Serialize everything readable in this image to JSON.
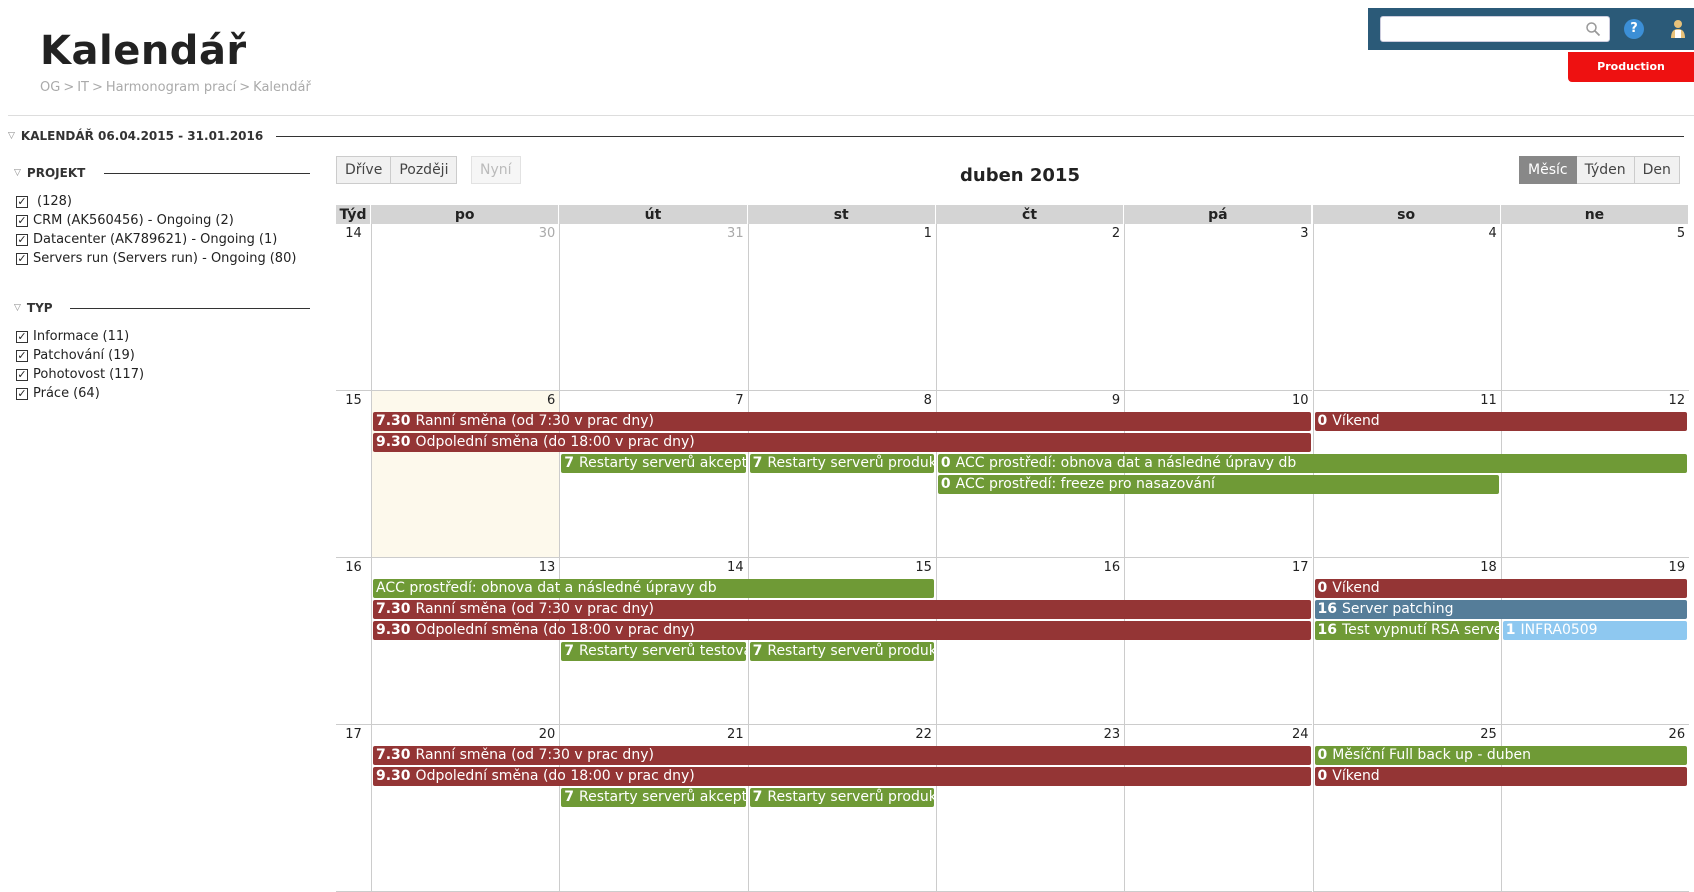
{
  "header": {
    "title": "Kalendář",
    "breadcrumb": [
      "OG",
      "IT",
      "Harmonogram prací",
      "Kalendář"
    ],
    "breadcrumb_sep": ">",
    "search_placeholder": "",
    "help_label": "?",
    "environment": "Production"
  },
  "calendar_section": {
    "title": "KALENDÁŘ 06.04.2015 - 31.01.2016"
  },
  "filters": {
    "project": {
      "title": "PROJEKT",
      "items": [
        {
          "label": "",
          "count": "(128)",
          "checked": true
        },
        {
          "label": "CRM (AK560456) - Ongoing",
          "count": "(2)",
          "checked": true
        },
        {
          "label": "Datacenter (AK789621) - Ongoing",
          "count": "(1)",
          "checked": true
        },
        {
          "label": "Servers run (Servers run) - Ongoing",
          "count": "(80)",
          "checked": true
        }
      ]
    },
    "type": {
      "title": "TYP",
      "items": [
        {
          "label": "Informace",
          "count": "(11)",
          "checked": true
        },
        {
          "label": "Patchování",
          "count": "(19)",
          "checked": true
        },
        {
          "label": "Pohotovost",
          "count": "(117)",
          "checked": true
        },
        {
          "label": "Práce",
          "count": "(64)",
          "checked": true
        }
      ]
    }
  },
  "toolbar": {
    "earlier": "Dříve",
    "later": "Později",
    "now": "Nyní",
    "month_title": "duben 2015",
    "views": [
      "Měsíc",
      "Týden",
      "Den"
    ],
    "active_view": "Měsíc"
  },
  "calendar": {
    "week_header": "Týd",
    "day_headers": [
      "po",
      "út",
      "st",
      "čt",
      "pá",
      "so",
      "ne"
    ],
    "weeks": [
      {
        "week": "14",
        "days": [
          {
            "num": "30",
            "other": true
          },
          {
            "num": "31",
            "other": true
          },
          {
            "num": "1"
          },
          {
            "num": "2"
          },
          {
            "num": "3"
          },
          {
            "num": "4"
          },
          {
            "num": "5"
          }
        ],
        "events": []
      },
      {
        "week": "15",
        "days": [
          {
            "num": "6",
            "today": true
          },
          {
            "num": "7"
          },
          {
            "num": "8"
          },
          {
            "num": "9"
          },
          {
            "num": "10"
          },
          {
            "num": "11"
          },
          {
            "num": "12"
          }
        ],
        "events": [
          {
            "time": "7.30",
            "text": "Ranní směna (od 7:30 v prac dny)",
            "start": 0,
            "span": 5,
            "lane": 0,
            "color": "red"
          },
          {
            "time": "0",
            "text": "Víkend",
            "start": 5,
            "span": 2,
            "lane": 0,
            "color": "red"
          },
          {
            "time": "9.30",
            "text": "Odpolední směna (do 18:00 v prac dny)",
            "start": 0,
            "span": 5,
            "lane": 1,
            "color": "red"
          },
          {
            "time": "7",
            "text": "Restarty serverů akceptačních",
            "start": 1,
            "span": 1,
            "lane": 2,
            "color": "green"
          },
          {
            "time": "7",
            "text": "Restarty serverů produkčních",
            "start": 2,
            "span": 1,
            "lane": 2,
            "color": "green"
          },
          {
            "time": "0",
            "text": "ACC prostředí: obnova dat a následné úpravy db",
            "start": 3,
            "span": 4,
            "lane": 2,
            "color": "green"
          },
          {
            "time": "0",
            "text": "ACC prostředí: freeze pro nasazování",
            "start": 3,
            "span": 3,
            "lane": 3,
            "color": "green"
          }
        ]
      },
      {
        "week": "16",
        "days": [
          {
            "num": "13"
          },
          {
            "num": "14"
          },
          {
            "num": "15"
          },
          {
            "num": "16"
          },
          {
            "num": "17"
          },
          {
            "num": "18"
          },
          {
            "num": "19"
          }
        ],
        "events": [
          {
            "time": "",
            "text": "ACC prostředí: obnova dat a následné úpravy db",
            "start": 0,
            "span": 3,
            "lane": 0,
            "color": "green"
          },
          {
            "time": "0",
            "text": "Víkend",
            "start": 5,
            "span": 2,
            "lane": 0,
            "color": "red"
          },
          {
            "time": "7.30",
            "text": "Ranní směna (od 7:30 v prac dny)",
            "start": 0,
            "span": 5,
            "lane": 1,
            "color": "red"
          },
          {
            "time": "16",
            "text": "Server patching",
            "start": 5,
            "span": 2,
            "lane": 1,
            "color": "blue"
          },
          {
            "time": "9.30",
            "text": "Odpolední směna (do 18:00 v prac dny)",
            "start": 0,
            "span": 5,
            "lane": 2,
            "color": "red"
          },
          {
            "time": "16",
            "text": "Test vypnutí RSA serverů",
            "start": 5,
            "span": 1,
            "lane": 2,
            "color": "green"
          },
          {
            "time": "1",
            "text": "INFRA0509",
            "start": 6,
            "span": 1,
            "lane": 2,
            "color": "lightblue"
          },
          {
            "time": "7",
            "text": "Restarty serverů testovacích",
            "start": 1,
            "span": 1,
            "lane": 3,
            "color": "green"
          },
          {
            "time": "7",
            "text": "Restarty serverů produkčních",
            "start": 2,
            "span": 1,
            "lane": 3,
            "color": "green"
          }
        ]
      },
      {
        "week": "17",
        "days": [
          {
            "num": "20"
          },
          {
            "num": "21"
          },
          {
            "num": "22"
          },
          {
            "num": "23"
          },
          {
            "num": "24"
          },
          {
            "num": "25"
          },
          {
            "num": "26"
          }
        ],
        "events": [
          {
            "time": "7.30",
            "text": "Ranní směna (od 7:30 v prac dny)",
            "start": 0,
            "span": 5,
            "lane": 0,
            "color": "red"
          },
          {
            "time": "0",
            "text": "Měsíční Full back up - duben",
            "start": 5,
            "span": 2,
            "lane": 0,
            "color": "green"
          },
          {
            "time": "9.30",
            "text": "Odpolední směna (do 18:00 v prac dny)",
            "start": 0,
            "span": 5,
            "lane": 1,
            "color": "red"
          },
          {
            "time": "0",
            "text": "Víkend",
            "start": 5,
            "span": 2,
            "lane": 1,
            "color": "red"
          },
          {
            "time": "7",
            "text": "Restarty serverů akceptačních",
            "start": 1,
            "span": 1,
            "lane": 2,
            "color": "green"
          },
          {
            "time": "7",
            "text": "Restarty serverů produkčních",
            "start": 2,
            "span": 1,
            "lane": 2,
            "color": "green"
          }
        ]
      }
    ]
  }
}
